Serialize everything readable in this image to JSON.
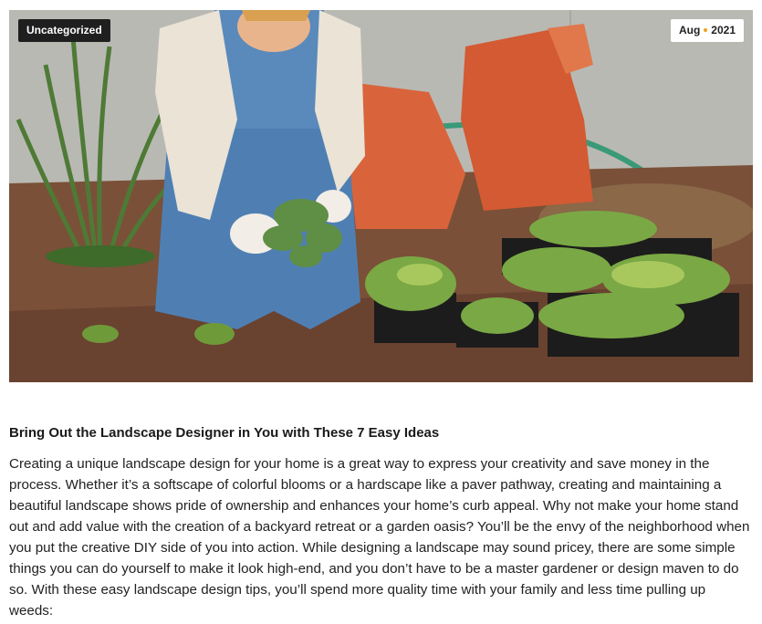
{
  "post": {
    "category": "Uncategorized",
    "date": {
      "month": "Aug",
      "year": "2021"
    },
    "title": "Bring Out the Landscape Designer in You with These 7 Easy Ideas",
    "excerpt": "Creating a unique landscape design for your home is a great way to express your creativity and save money in the process. Whether it’s a softscape of colorful blooms or a hardscape like a paver pathway, creating and maintaining a beautiful landscape shows pride of ownership and enhances your home’s curb appeal. Why not make your home stand out and add value with the creation of a backyard retreat or a garden oasis? You’ll be the envy of the neighborhood when you put the creative DIY side of you into action. While designing a landscape may sound pricey, there are some simple things you can do yourself to make it look high-end, and you don’t have to be a master gardener or design maven to do so. With these easy landscape design tips, you’ll spend more quality time with your family and less time pulling up weeds:"
  },
  "colors": {
    "badge_dark": "#1f1f1f",
    "date_dot": "#f0a020",
    "wall": "#b9b9b4",
    "soil": "#7a5038",
    "denim": "#4f7fb2",
    "bag": "#d9643c",
    "leaf": "#6f9a3a"
  }
}
